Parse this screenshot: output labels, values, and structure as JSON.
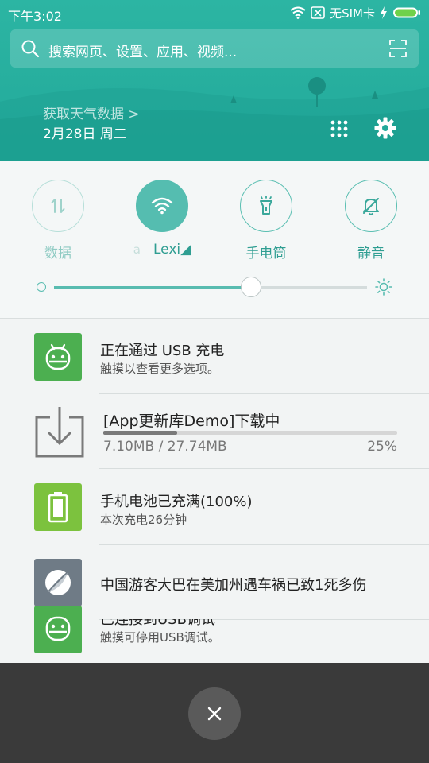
{
  "status_bar": {
    "time": "下午3:02",
    "carrier": "无SIM卡",
    "icons": [
      "wifi-icon",
      "no-sim-icon",
      "charging-icon",
      "battery-icon"
    ]
  },
  "search": {
    "placeholder": "搜索网页、设置、应用、视频..."
  },
  "header": {
    "weather_link": "获取天气数据 >",
    "date": "2月28日 周二",
    "icons": [
      "grid-icon",
      "gear-icon"
    ]
  },
  "toggles": [
    {
      "label": "数据",
      "icon": "data-arrows-icon",
      "active": false
    },
    {
      "label": "Lexi◢",
      "label_prefix": "a",
      "icon": "wifi-icon",
      "active": true
    },
    {
      "label": "手电筒",
      "icon": "flashlight-icon",
      "active": false
    },
    {
      "label": "静音",
      "icon": "bell-off-icon",
      "active": false
    }
  ],
  "brightness": {
    "level": 0.63
  },
  "notifications": {
    "usb_charging": {
      "title": "正在通过 USB 充电",
      "subtitle": "触摸以查看更多选项。",
      "icon": "android-icon"
    },
    "download": {
      "title": "[App更新库Demo]下载中",
      "size": "7.10MB / 27.74MB",
      "percent_label": "25%",
      "progress": 0.25,
      "icon": "download-icon"
    },
    "battery_full": {
      "title": "手机电池已充满(100%)",
      "subtitle": "本次充电26分钟",
      "icon": "battery-full-icon"
    },
    "news": {
      "title": "中国游客大巴在美加州遇车祸已致1死多伤",
      "icon": "news-icon"
    },
    "usb_debug": {
      "title": "已连接到USB调试",
      "subtitle": "触摸可停用USB调试。",
      "icon": "android-icon"
    }
  },
  "colors": {
    "header": "#22a99a",
    "accent": "#55bdb0",
    "green_icon": "#4caf50",
    "battery_green": "#7cc23e",
    "news_gray": "#6f7b86"
  }
}
